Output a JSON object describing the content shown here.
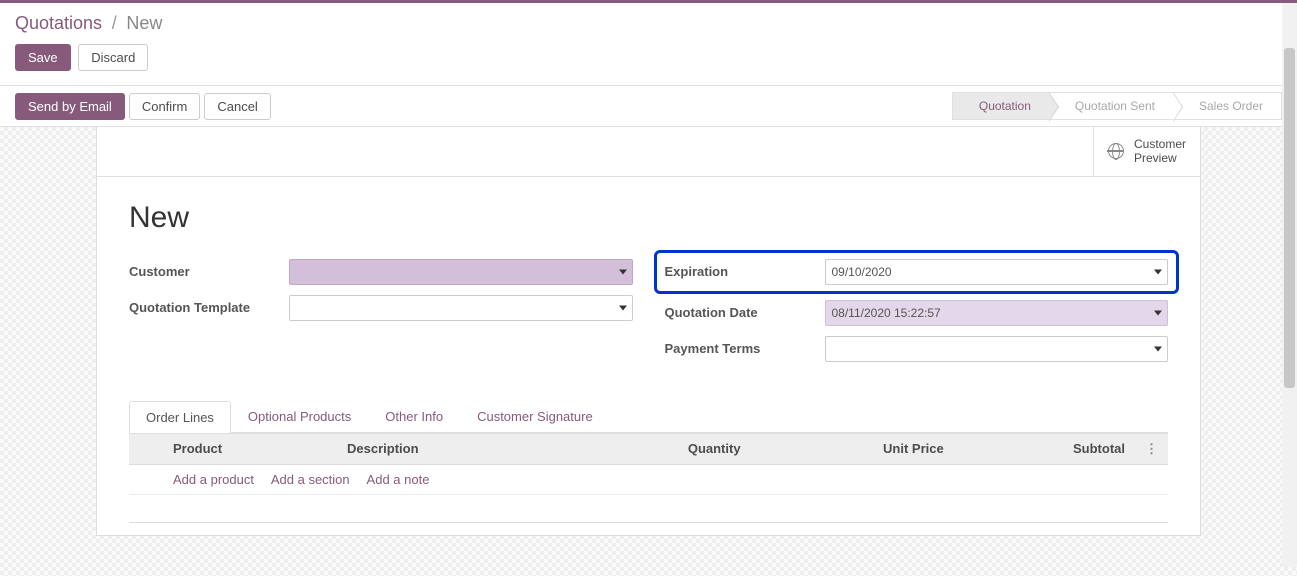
{
  "breadcrumb": {
    "root": "Quotations",
    "current": "New"
  },
  "buttons": {
    "save": "Save",
    "discard": "Discard",
    "send_email": "Send by Email",
    "confirm": "Confirm",
    "cancel": "Cancel"
  },
  "status": {
    "steps": [
      "Quotation",
      "Quotation Sent",
      "Sales Order"
    ],
    "active_index": 0
  },
  "preview": {
    "line1": "Customer",
    "line2": "Preview"
  },
  "record": {
    "title": "New"
  },
  "fields": {
    "left": {
      "customer": {
        "label": "Customer",
        "value": ""
      },
      "template": {
        "label": "Quotation Template",
        "value": ""
      }
    },
    "right": {
      "expiration": {
        "label": "Expiration",
        "value": "09/10/2020"
      },
      "quotation_date": {
        "label": "Quotation Date",
        "value": "08/11/2020 15:22:57"
      },
      "payment_terms": {
        "label": "Payment Terms",
        "value": ""
      }
    }
  },
  "tabs": [
    "Order Lines",
    "Optional Products",
    "Other Info",
    "Customer Signature"
  ],
  "active_tab": 0,
  "table": {
    "columns": [
      "Product",
      "Description",
      "Quantity",
      "Unit Price",
      "Subtotal"
    ],
    "add_links": [
      "Add a product",
      "Add a section",
      "Add a note"
    ]
  }
}
